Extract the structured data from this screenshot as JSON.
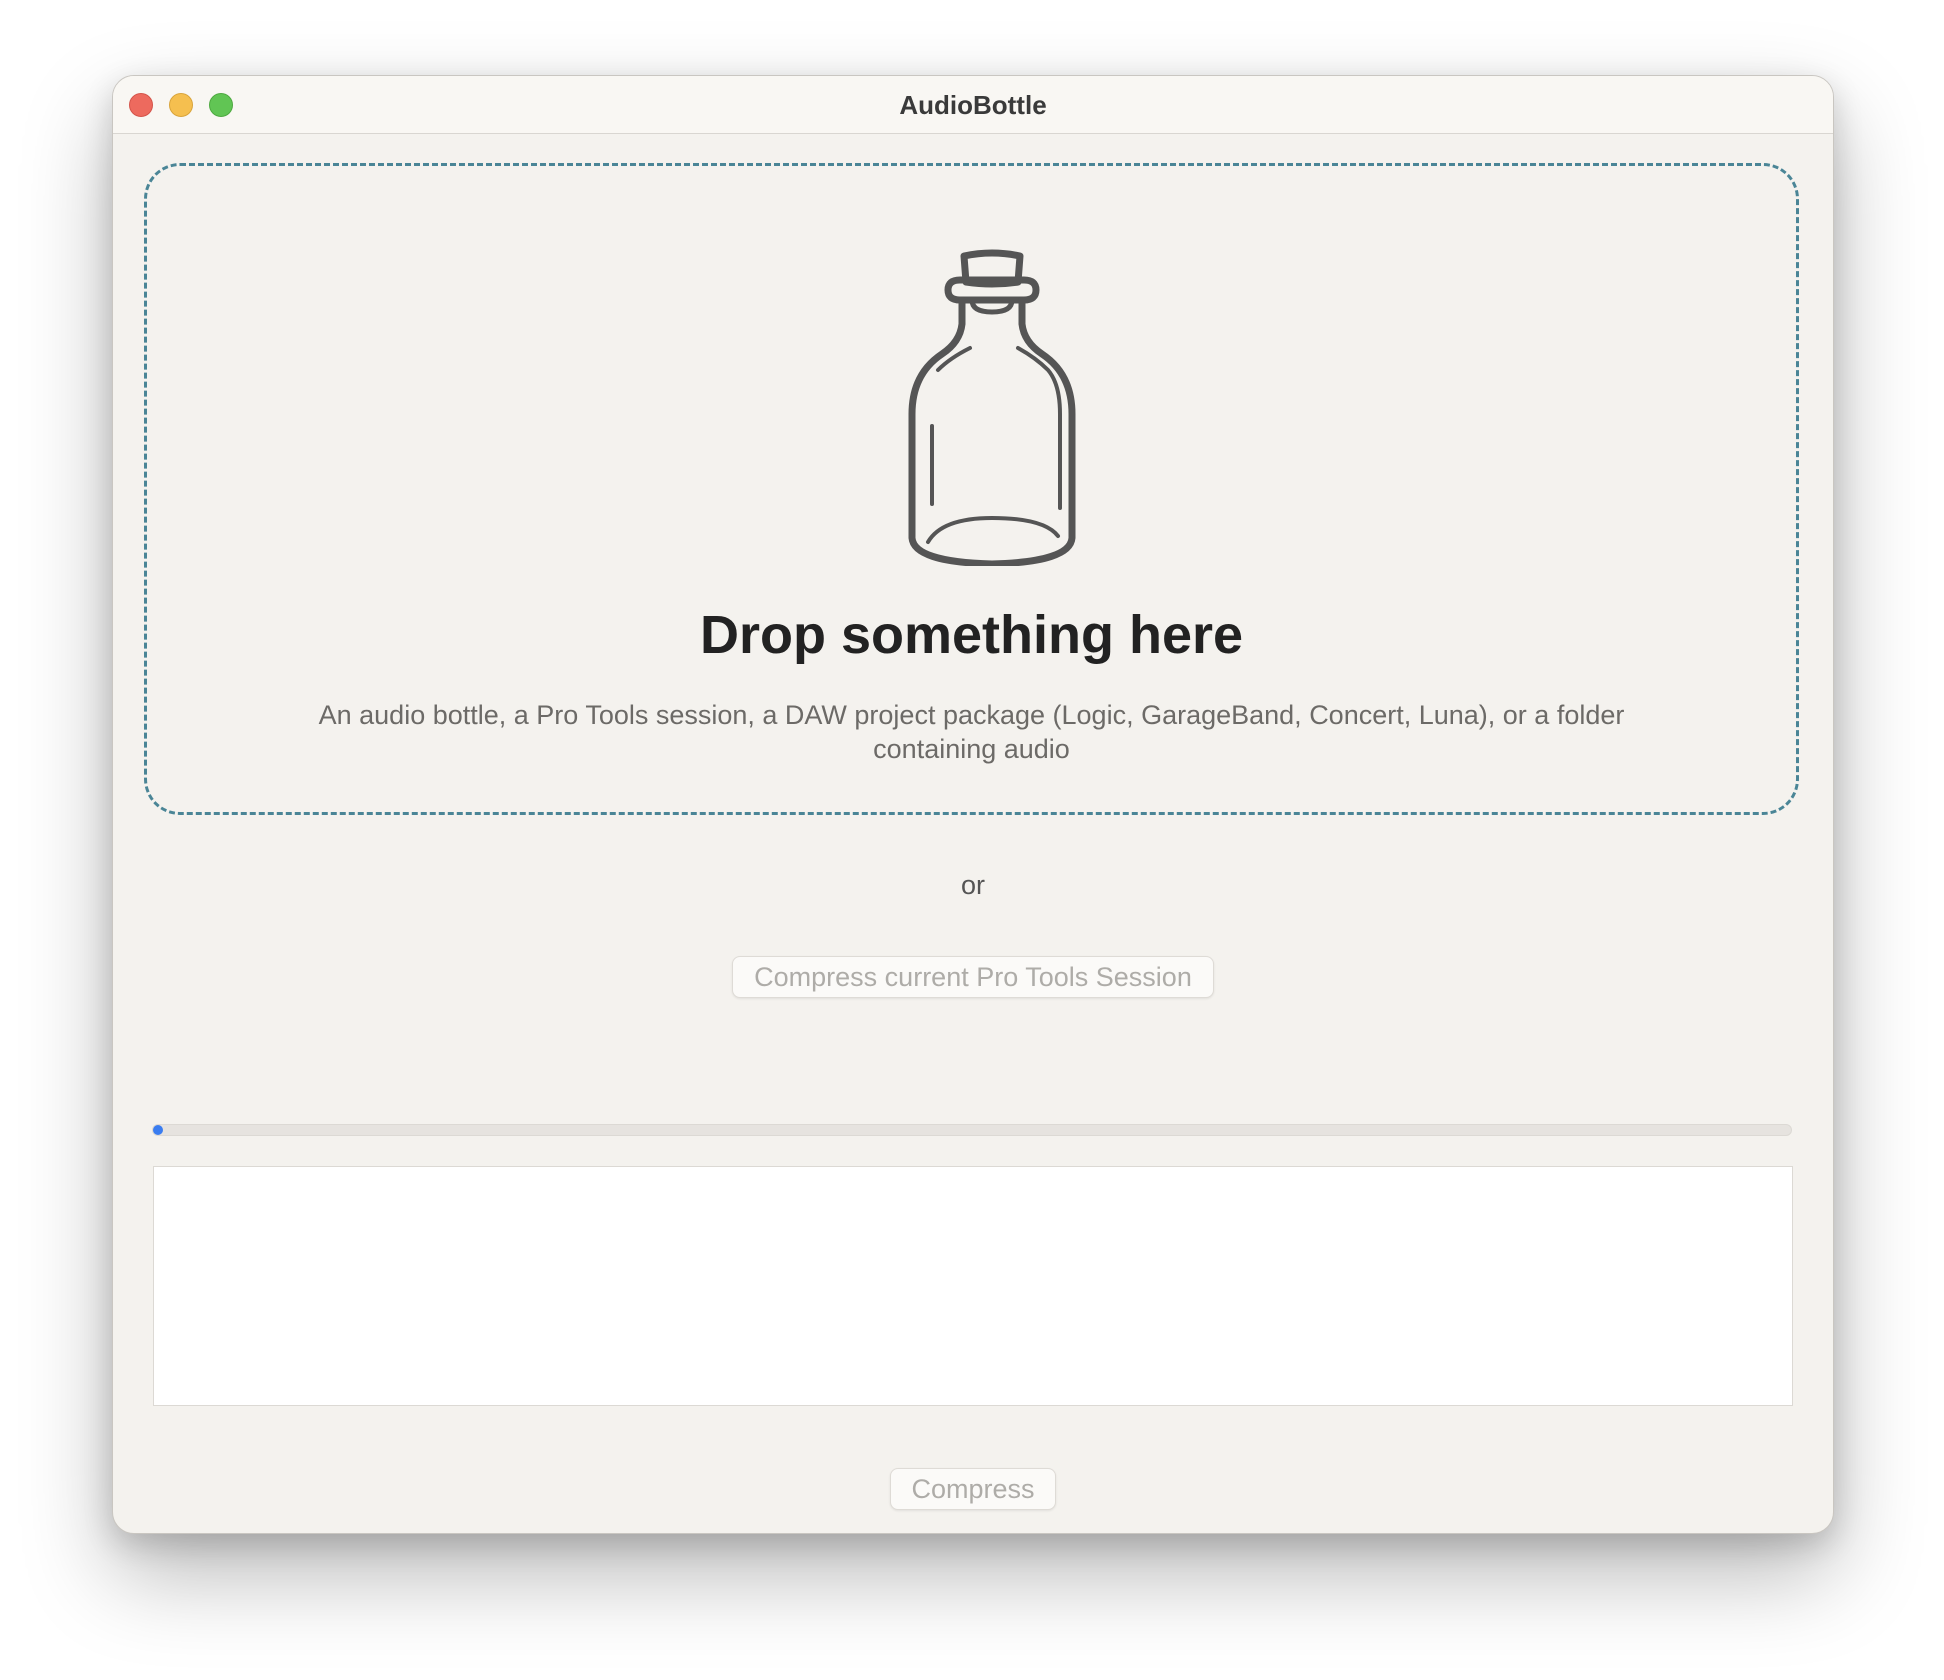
{
  "window": {
    "title": "AudioBottle"
  },
  "dropzone": {
    "icon": "bottle-icon",
    "title": "Drop something here",
    "subtitle": "An audio bottle, a Pro Tools session, a DAW project package (Logic, GarageBand, Concert, Luna), or a folder containing audio"
  },
  "separator": {
    "label": "or"
  },
  "actions": {
    "pro_tools_label": "Compress current Pro Tools Session",
    "compress_label": "Compress"
  },
  "progress": {
    "fraction": 0.0
  },
  "log": {
    "text": ""
  },
  "colors": {
    "accent": "#3a7df0",
    "dropzone_border": "#4a8596",
    "close": "#ed6a5e",
    "minimize": "#f5bf4f",
    "zoom": "#61c554"
  }
}
